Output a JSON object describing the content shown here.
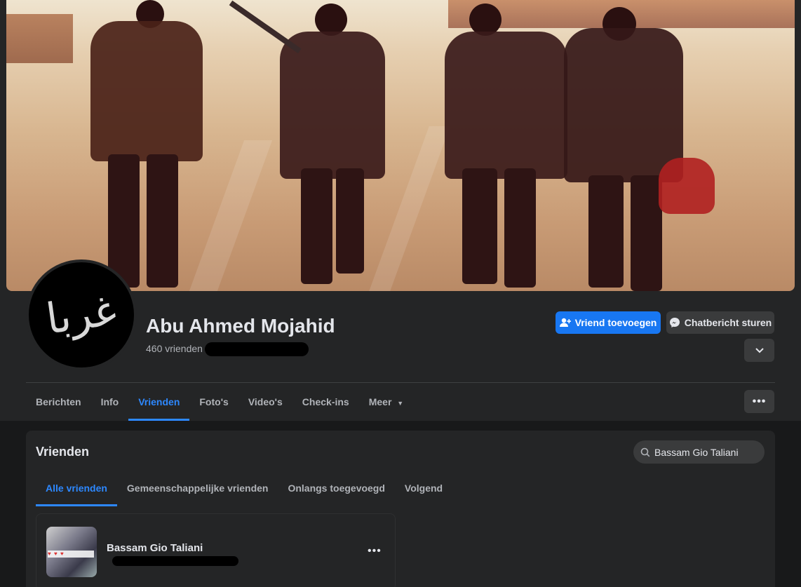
{
  "profile": {
    "name": "Abu Ahmed Mojahid",
    "friends_count": "460 vrienden",
    "avatar_glyph": "غربا"
  },
  "actions": {
    "add_friend": "Vriend toevoegen",
    "message": "Chatbericht sturen",
    "dropdown_icon": "chevron-down-icon",
    "more_icon": "more-dots-icon"
  },
  "profile_tabs": [
    {
      "label": "Berichten",
      "active": false
    },
    {
      "label": "Info",
      "active": false
    },
    {
      "label": "Vrienden",
      "active": true
    },
    {
      "label": "Foto's",
      "active": false
    },
    {
      "label": "Video's",
      "active": false
    },
    {
      "label": "Check-ins",
      "active": false
    },
    {
      "label": "Meer",
      "active": false
    }
  ],
  "friends_panel": {
    "title": "Vrienden",
    "search_value": "Bassam Gio Taliani",
    "tabs": [
      {
        "label": "Alle vrienden",
        "active": true
      },
      {
        "label": "Gemeenschappelijke vrienden",
        "active": false
      },
      {
        "label": "Onlangs toegevoegd",
        "active": false
      },
      {
        "label": "Volgend",
        "active": false
      }
    ],
    "results": [
      {
        "name": "Bassam Gio Taliani"
      }
    ]
  },
  "colors": {
    "accent": "#2d88ff",
    "primary_button": "#1877f2",
    "surface": "#242526",
    "background": "#18191a"
  }
}
